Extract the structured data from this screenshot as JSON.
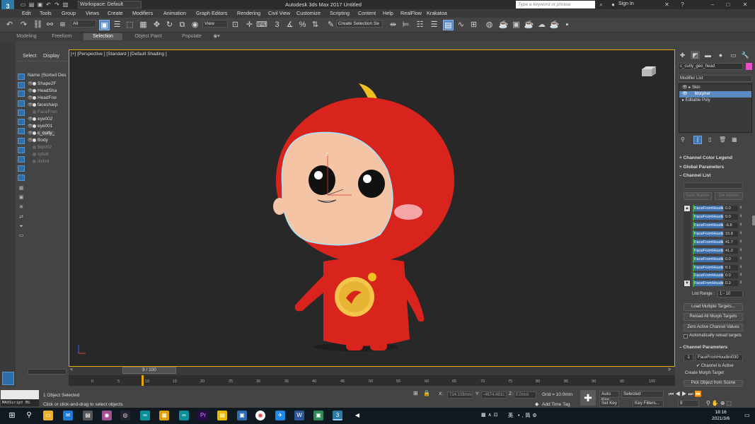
{
  "titlebar": {
    "app_icon": "3",
    "workspace": "Workspace: Default",
    "title": "Autodesk 3ds Max 2017     Untitled",
    "search_placeholder": "Type a keyword or phrase",
    "signin": "Sign In"
  },
  "menus": [
    "Edit",
    "Tools",
    "Group",
    "Views",
    "Create",
    "Modifiers",
    "Animation",
    "Graph Editors",
    "Rendering",
    "Civil View",
    "Customize",
    "Scripting",
    "Content",
    "Help",
    "RealFlow",
    "Krakatoa"
  ],
  "toolbar": {
    "filter": "All",
    "view": "View",
    "selection_set": "Create Selection Se"
  },
  "ribbon_tabs": [
    "Modeling",
    "Freeform",
    "Selection",
    "Object Paint",
    "Populate"
  ],
  "explorer": {
    "tabs": [
      "Select",
      "Display"
    ],
    "header": "Name (Sorted Des",
    "rows": [
      {
        "name": "Shape2F",
        "dim": false
      },
      {
        "name": "HeadSha",
        "dim": false
      },
      {
        "name": "HeadFror",
        "dim": false
      },
      {
        "name": "facesharp",
        "dim": false
      },
      {
        "name": "FaceFron",
        "dim": true
      },
      {
        "name": "eye002",
        "dim": false
      },
      {
        "name": "eye001",
        "dim": false
      },
      {
        "name": "c_curly_",
        "dim": false
      },
      {
        "name": "Body",
        "dim": false
      },
      {
        "name": "Bip002",
        "dim": true
      },
      {
        "name": "xptvd",
        "dim": true
      },
      {
        "name": "iiixfvd",
        "dim": true
      }
    ]
  },
  "viewport": {
    "label": "[+] [Perspective ] [Standard ] [Default Shading ]"
  },
  "timeline": {
    "slider": "9 / 100",
    "ticks": [
      "0",
      "5",
      "10",
      "15",
      "20",
      "25",
      "30",
      "35",
      "40",
      "45",
      "50",
      "55",
      "60",
      "65",
      "70",
      "75",
      "80",
      "85",
      "90",
      "95",
      "100"
    ]
  },
  "status": {
    "maxscript": "MAXScript Mi",
    "selected": "1 Object Selected",
    "prompt": "Click or click-and-drag to select objects",
    "x_label": "X:",
    "x_value": "714.108mm",
    "y_label": "Y:",
    "y_value": "-4674.481c",
    "z_label": "Z:",
    "z_value": "0.0mm",
    "grid": "Grid = 10.0mm",
    "add_time_tag": "Add Time Tag",
    "auto_key": "Auto Key",
    "set_key": "Set Key",
    "key_mode": "Selected",
    "key_filters": "Key Filters...",
    "frame": "9"
  },
  "command_panel": {
    "object_name": "c_curly_geo_head",
    "modifier_list": "Modifier List",
    "stack": [
      {
        "label": "Skin",
        "selected": false
      },
      {
        "label": "Morpher",
        "selected": true
      },
      {
        "label": "Editable Poly",
        "selected": false
      }
    ],
    "rollouts": {
      "color_legend": "Channel Color Legend",
      "global": "Global Parameters",
      "channel_list": "Channel List",
      "channel_params": "Channel Parameters"
    },
    "save_marker": "Save Marker",
    "del_marker": "Del Marker",
    "channels": [
      {
        "name": "FaceFromHoudini0",
        "value": "0.0"
      },
      {
        "name": "FaceFromHoudini0",
        "value": "0.0"
      },
      {
        "name": "FaceFromHoudini0",
        "value": "-6.8"
      },
      {
        "name": "FaceFromHoudini0",
        "value": "15.8"
      },
      {
        "name": "FaceFromHoudini0",
        "value": "41.7"
      },
      {
        "name": "FaceFromHoudini0",
        "value": "41.2"
      },
      {
        "name": "FaceFromHoudini0",
        "value": "0.0"
      },
      {
        "name": "FaceFromHoudini0",
        "value": "0.1"
      },
      {
        "name": "FaceFromHoudini0",
        "value": "0.0"
      },
      {
        "name": "FaceFromHoudini0",
        "value": "0.0"
      }
    ],
    "list_range_label": "List Range :",
    "list_range_value": "1 - 10",
    "load_multiple": "Load Multiple Targets...",
    "reload_all": "Reload All Morph Targets",
    "zero_active": "Zero Active Channel Values",
    "auto_reload": "Automatically reload targets",
    "channel_number": "1",
    "channel_name": "FaceFromHoudini030",
    "channel_active": "Channel is Active",
    "create_morph": "Create Morph Target",
    "pick_object": "Pick Object from Scene"
  },
  "taskbar": {
    "ime": "英",
    "time": "18:16",
    "date": "2021/3/6"
  },
  "colors": {
    "accent": "#5b8ac2",
    "viewport_border": "#e8a900",
    "character_red": "#d8241c",
    "skin": "#f4c4a4"
  }
}
